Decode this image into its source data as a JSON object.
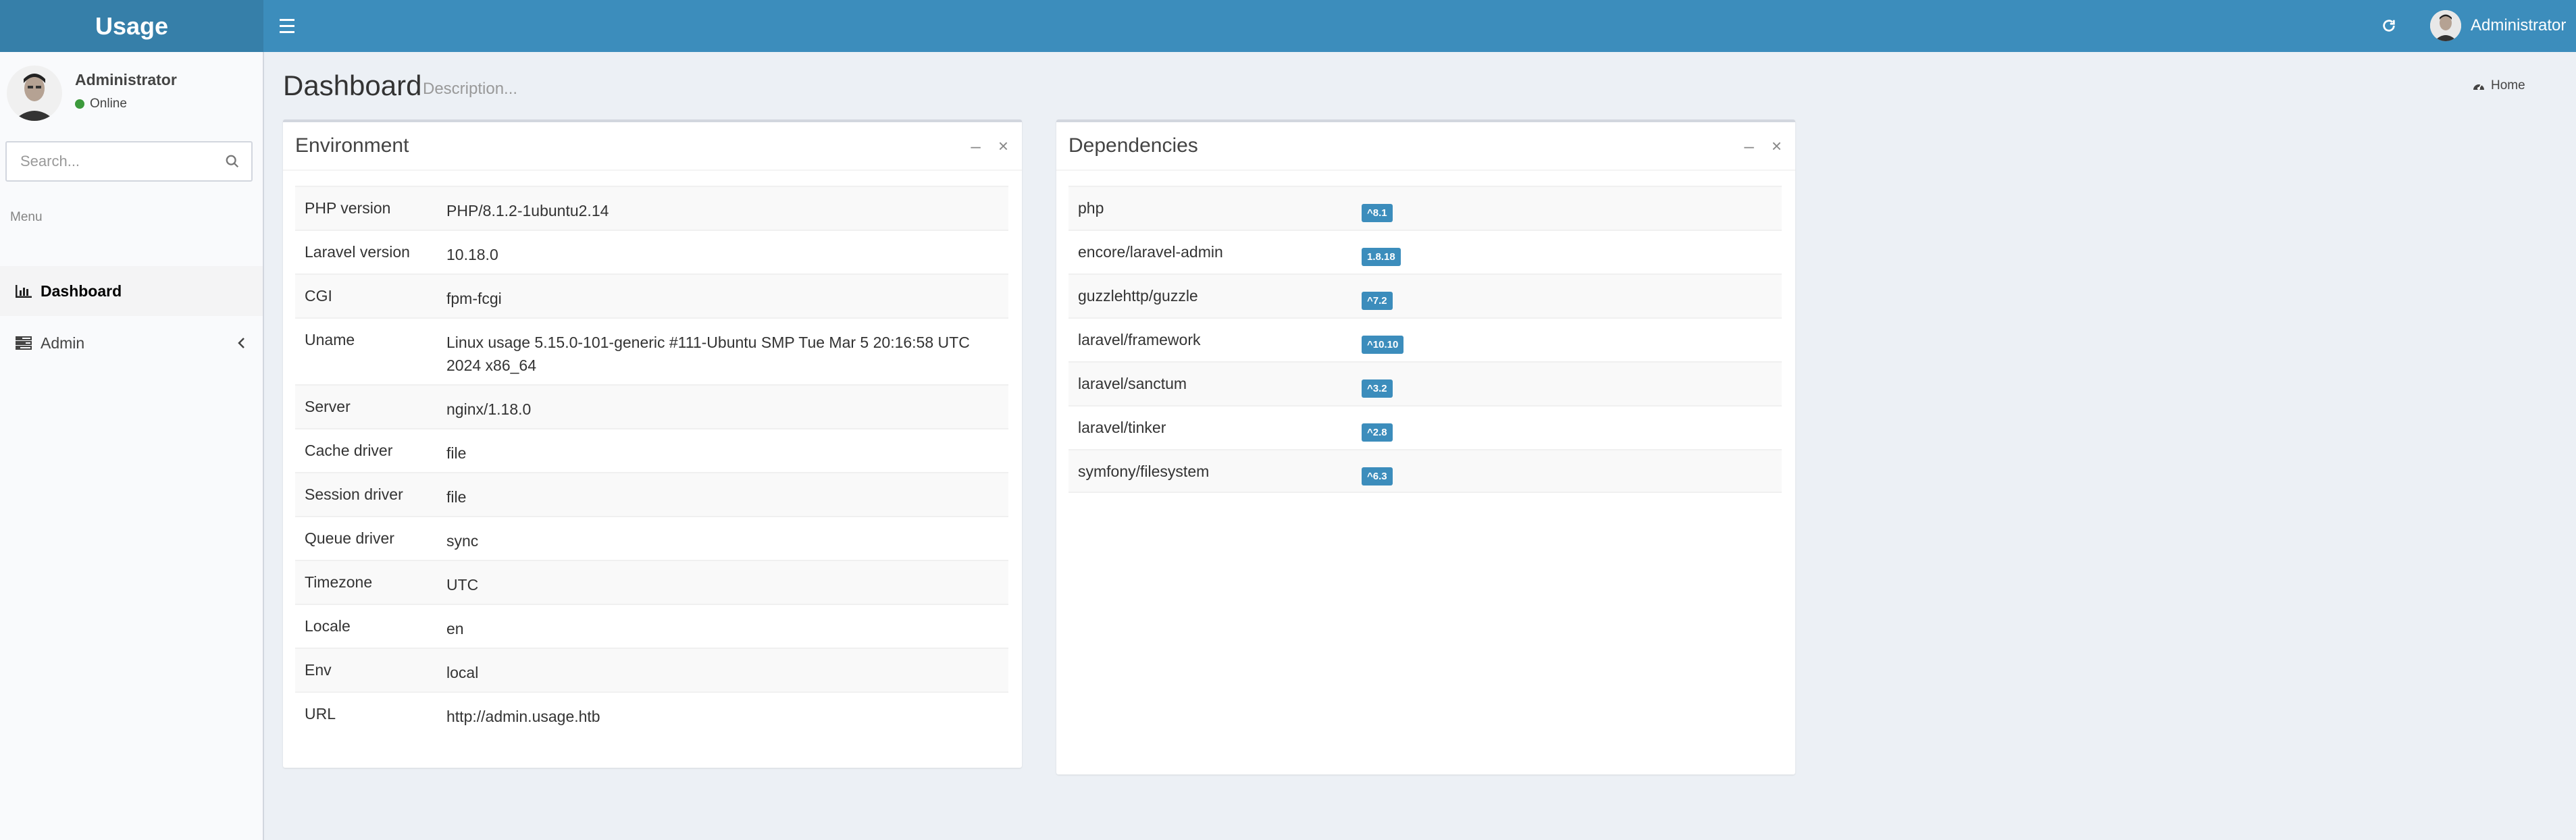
{
  "app": {
    "logo": "Usage"
  },
  "header": {
    "user_name": "Administrator"
  },
  "sidebar": {
    "user_name": "Administrator",
    "status": "Online",
    "search_placeholder": "Search...",
    "menu_header": "Menu",
    "items": [
      {
        "label": "Dashboard",
        "icon": "bar-chart-icon",
        "active": true
      },
      {
        "label": "Admin",
        "icon": "tasks-icon",
        "active": false
      }
    ]
  },
  "content": {
    "title": "Dashboard",
    "description": "Description...",
    "breadcrumb": "Home"
  },
  "environment": {
    "title": "Environment",
    "rows": [
      {
        "key": "PHP version",
        "value": "PHP/8.1.2-1ubuntu2.14"
      },
      {
        "key": "Laravel version",
        "value": "10.18.0"
      },
      {
        "key": "CGI",
        "value": "fpm-fcgi"
      },
      {
        "key": "Uname",
        "value": "Linux usage 5.15.0-101-generic #111-Ubuntu SMP Tue Mar 5 20:16:58 UTC 2024 x86_64"
      },
      {
        "key": "Server",
        "value": "nginx/1.18.0"
      },
      {
        "key": "Cache driver",
        "value": "file"
      },
      {
        "key": "Session driver",
        "value": "file"
      },
      {
        "key": "Queue driver",
        "value": "sync"
      },
      {
        "key": "Timezone",
        "value": "UTC"
      },
      {
        "key": "Locale",
        "value": "en"
      },
      {
        "key": "Env",
        "value": "local"
      },
      {
        "key": "URL",
        "value": "http://admin.usage.htb"
      }
    ]
  },
  "dependencies": {
    "title": "Dependencies",
    "rows": [
      {
        "name": "php",
        "version": "^8.1"
      },
      {
        "name": "encore/laravel-admin",
        "version": "1.8.18"
      },
      {
        "name": "guzzlehttp/guzzle",
        "version": "^7.2"
      },
      {
        "name": "laravel/framework",
        "version": "^10.10"
      },
      {
        "name": "laravel/sanctum",
        "version": "^3.2"
      },
      {
        "name": "laravel/tinker",
        "version": "^2.8"
      },
      {
        "name": "symfony/filesystem",
        "version": "^6.3"
      }
    ]
  },
  "colors": {
    "header": "#3c8dbc",
    "logo_bg": "#367fa9",
    "badge": "#3c8dbc",
    "online": "#3c9a3c"
  }
}
